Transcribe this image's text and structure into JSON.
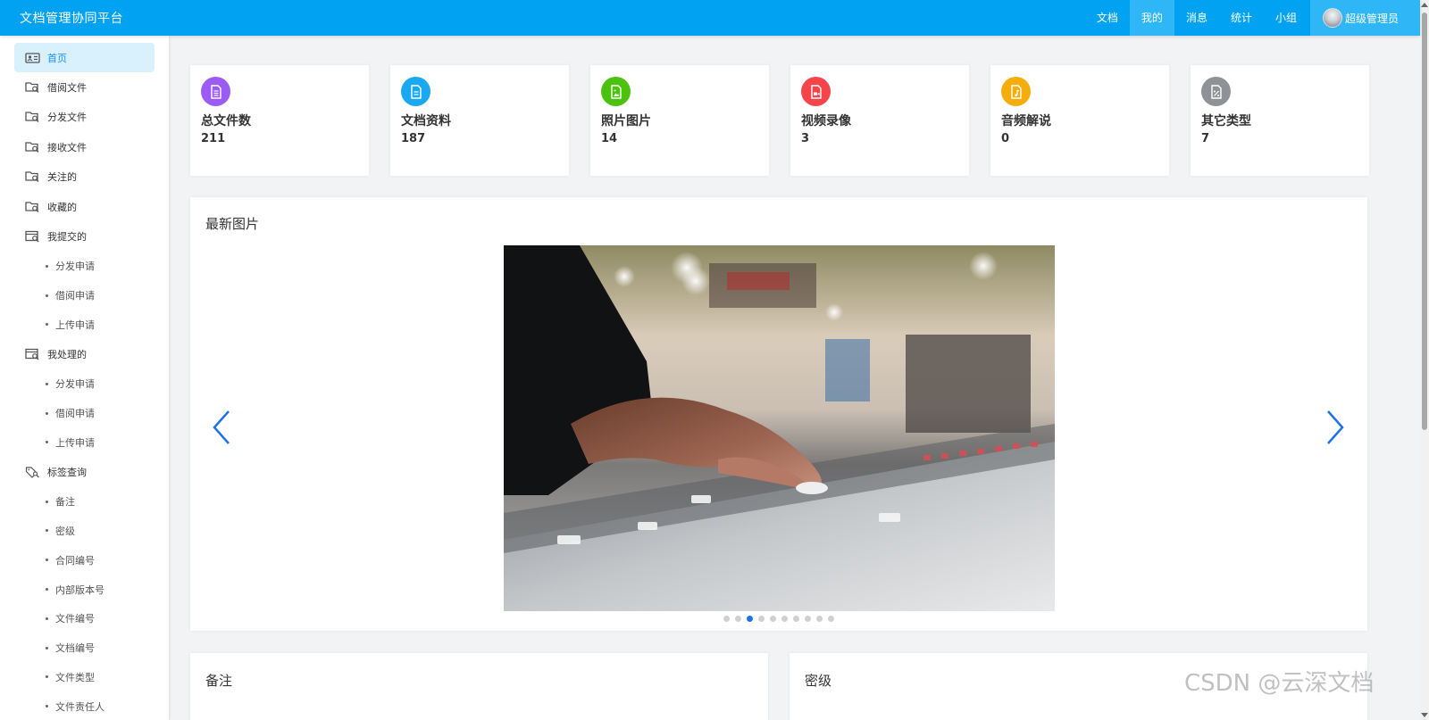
{
  "header": {
    "title": "文档管理协同平台",
    "nav": [
      {
        "label": "文档",
        "active": false
      },
      {
        "label": "我的",
        "active": true
      },
      {
        "label": "消息",
        "active": false
      },
      {
        "label": "统计",
        "active": false
      },
      {
        "label": "小组",
        "active": false
      }
    ],
    "user_name": "超级管理员",
    "bar_color": "#00a2f1"
  },
  "sidebar": {
    "home": "首页",
    "borrow": "借阅文件",
    "distribute": "分发文件",
    "receive": "接收文件",
    "follow": "关注的",
    "favorite": "收藏的",
    "submitted": "我提交的",
    "submitted_subs": [
      "分发申请",
      "借阅申请",
      "上传申请"
    ],
    "handled": "我处理的",
    "handled_subs": [
      "分发申请",
      "借阅申请",
      "上传申请"
    ],
    "tag_query": "标签查询",
    "tag_subs": [
      "备注",
      "密级",
      "合同编号",
      "内部版本号",
      "文件编号",
      "文档编号",
      "文件类型",
      "文件责任人"
    ]
  },
  "stats": [
    {
      "label": "总文件数",
      "value": "211",
      "color": "#9b5cf6",
      "icon": "file-stack-icon"
    },
    {
      "label": "文档资料",
      "value": "187",
      "color": "#1aa8f0",
      "icon": "document-icon"
    },
    {
      "label": "照片图片",
      "value": "14",
      "color": "#4cc20e",
      "icon": "image-file-icon"
    },
    {
      "label": "视频录像",
      "value": "3",
      "color": "#f5454b",
      "icon": "video-file-icon"
    },
    {
      "label": "音频解说",
      "value": "0",
      "color": "#f5ad0c",
      "icon": "audio-file-icon"
    },
    {
      "label": "其它类型",
      "value": "7",
      "color": "#8e9196",
      "icon": "other-file-icon"
    }
  ],
  "carousel": {
    "title": "最新图片",
    "slide_count": 10,
    "active_index": 2,
    "accent": "#1a73e8"
  },
  "bottom": {
    "left_title": "备注",
    "right_title": "密级"
  },
  "watermark": "CSDN @云深文档"
}
